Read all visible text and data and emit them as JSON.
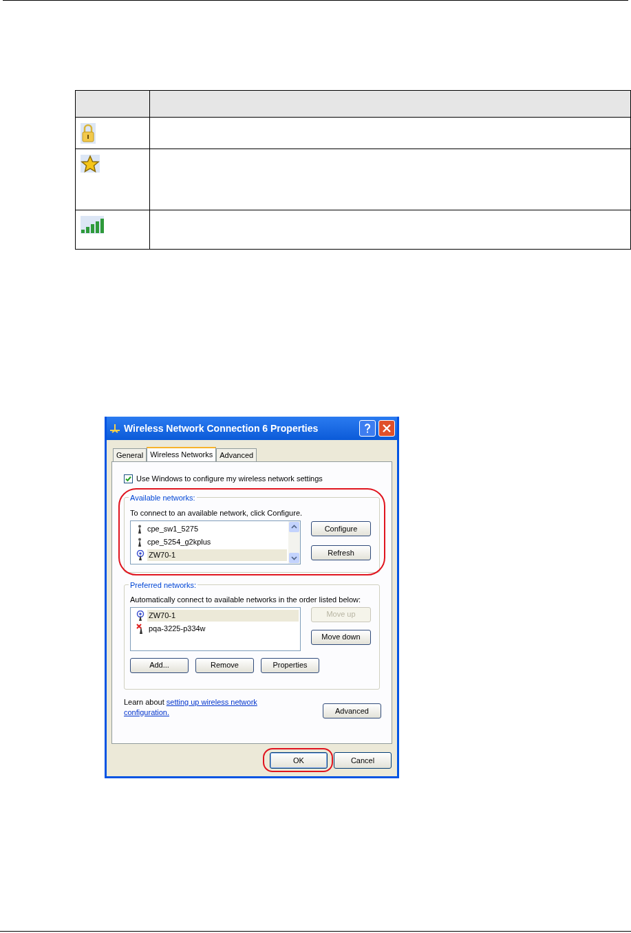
{
  "legend_table": {
    "rows": [
      {
        "kind": "lock"
      },
      {
        "kind": "star"
      },
      {
        "kind": "signal"
      }
    ]
  },
  "dialog": {
    "title": "Wireless Network Connection 6 Properties",
    "tabs": [
      {
        "label": "General",
        "selected": false
      },
      {
        "label": "Wireless Networks",
        "selected": true
      },
      {
        "label": "Advanced",
        "selected": false
      }
    ],
    "use_windows": {
      "label": "Use Windows to configure my wireless network settings",
      "checked": true
    },
    "available_networks": {
      "legend": "Available networks:",
      "highlighted": true,
      "instruction": "To connect to an available network, click Configure.",
      "networks": [
        {
          "name": "cpe_sw1_5275",
          "kind": "available",
          "selected": false
        },
        {
          "name": "cpe_5254_g2kplus",
          "kind": "available",
          "selected": false
        },
        {
          "name": "ZW70-1",
          "kind": "connected",
          "selected": true
        }
      ],
      "buttons": [
        {
          "label": "Configure",
          "disabled": false
        },
        {
          "label": "Refresh",
          "disabled": false
        }
      ]
    },
    "preferred_networks": {
      "legend": "Preferred networks:",
      "instruction": "Automatically connect to available networks in the order listed below:",
      "networks": [
        {
          "name": "ZW70-1",
          "kind": "connected",
          "selected": true
        },
        {
          "name": "pqa-3225-p334w",
          "kind": "unavailable",
          "selected": false
        }
      ],
      "side_buttons": [
        {
          "label": "Move up",
          "disabled": true
        },
        {
          "label": "Move down",
          "disabled": false
        }
      ],
      "buttons": [
        {
          "label": "Add...",
          "disabled": false
        },
        {
          "label": "Remove",
          "disabled": false
        },
        {
          "label": "Properties",
          "disabled": false
        }
      ]
    },
    "learn_about": {
      "text": "Learn about",
      "link": "setting up wireless network configuration."
    },
    "advanced_button": {
      "label": "Advanced",
      "disabled": false
    },
    "footer_buttons": [
      {
        "label": "OK",
        "highlighted": true
      },
      {
        "label": "Cancel",
        "highlighted": false
      }
    ]
  }
}
